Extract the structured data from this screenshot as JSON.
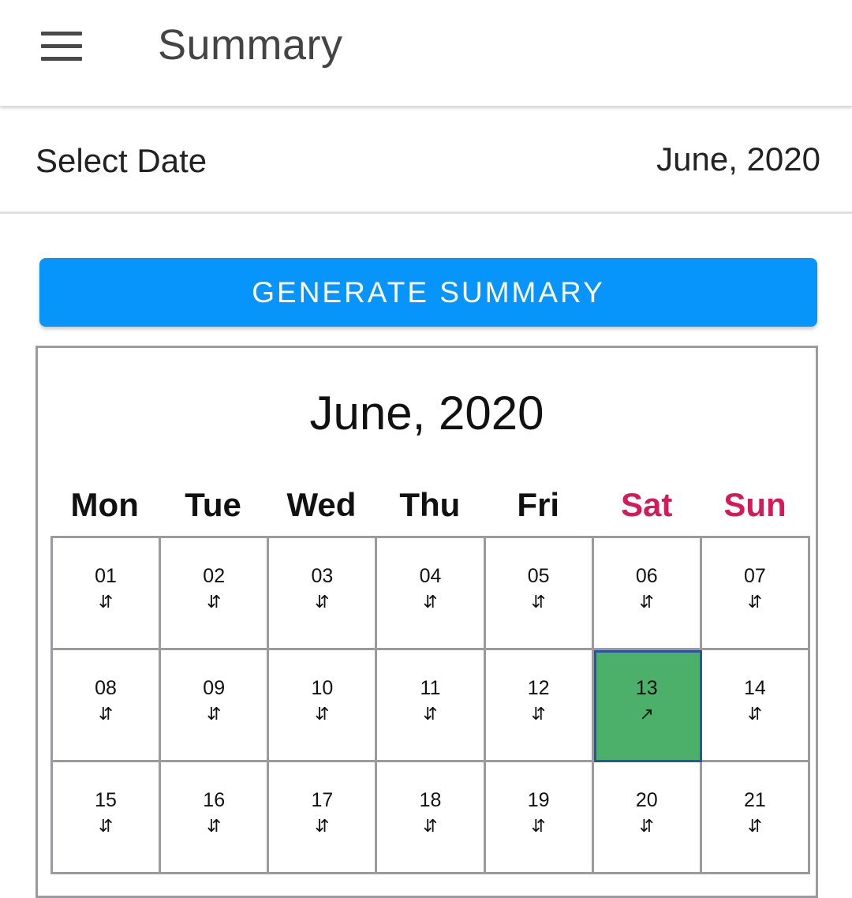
{
  "app_bar": {
    "title": "Summary",
    "menu_icon": "hamburger-menu-icon"
  },
  "date_selector": {
    "label": "Select Date",
    "value": "June, 2020"
  },
  "generate_button": {
    "label": "GENERATE SUMMARY",
    "color": "#0895fb"
  },
  "calendar": {
    "title": "June, 2020",
    "weekend_color": "#d41b5a",
    "selected_color": "#4caf6a",
    "weekdays": [
      {
        "label": "Mon",
        "weekend": false
      },
      {
        "label": "Tue",
        "weekend": false
      },
      {
        "label": "Wed",
        "weekend": false
      },
      {
        "label": "Thu",
        "weekend": false
      },
      {
        "label": "Fri",
        "weekend": false
      },
      {
        "label": "Sat",
        "weekend": true
      },
      {
        "label": "Sun",
        "weekend": true
      }
    ],
    "days": [
      {
        "day": "01",
        "icon": "⇵"
      },
      {
        "day": "02",
        "icon": "⇵"
      },
      {
        "day": "03",
        "icon": "⇵"
      },
      {
        "day": "04",
        "icon": "⇵"
      },
      {
        "day": "05",
        "icon": "⇵"
      },
      {
        "day": "06",
        "icon": "⇵"
      },
      {
        "day": "07",
        "icon": "⇵"
      },
      {
        "day": "08",
        "icon": "⇵"
      },
      {
        "day": "09",
        "icon": "⇵"
      },
      {
        "day": "10",
        "icon": "⇵"
      },
      {
        "day": "11",
        "icon": "⇵"
      },
      {
        "day": "12",
        "icon": "⇵"
      },
      {
        "day": "13",
        "icon": "↗",
        "selected": true
      },
      {
        "day": "14",
        "icon": "⇵"
      },
      {
        "day": "15",
        "icon": "⇵"
      },
      {
        "day": "16",
        "icon": "⇵"
      },
      {
        "day": "17",
        "icon": "⇵"
      },
      {
        "day": "18",
        "icon": "⇵"
      },
      {
        "day": "19",
        "icon": "⇵"
      },
      {
        "day": "20",
        "icon": "⇵"
      },
      {
        "day": "21",
        "icon": "⇵"
      }
    ]
  }
}
